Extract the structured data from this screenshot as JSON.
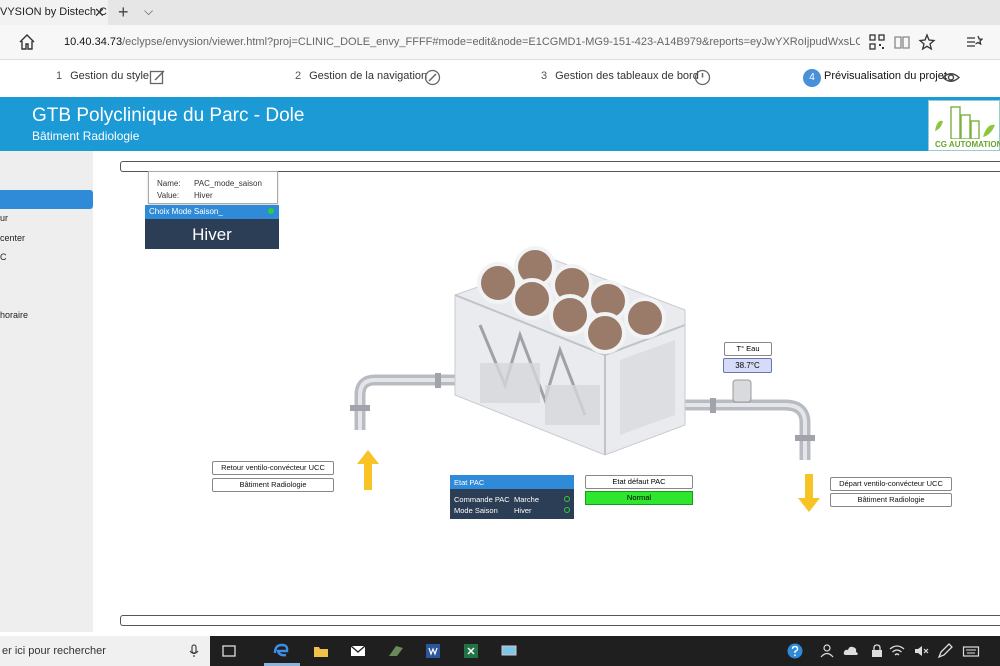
{
  "browser": {
    "tab_title": "VYSION by Distech C",
    "tab_close": "✕",
    "new_tab": "+",
    "tab_dropdown": "⌵",
    "url_host": "10.40.34.73",
    "url_path": "/eclypse/envysion/viewer.html?proj=CLINIC_DOLE_envy_FFFF#mode=edit&node=E1CGMD1-MG9-151-423-A14B979&reports=eyJwYXRoIjpudWxsLCJwYWdlIjpudWxsL"
  },
  "steps": [
    {
      "num": "1",
      "label": "Gestion du style"
    },
    {
      "num": "2",
      "label": "Gestion de la navigation"
    },
    {
      "num": "3",
      "label": "Gestion des tableaux de bord"
    },
    {
      "num": "4",
      "label": "Prévisualisation du projet"
    }
  ],
  "header": {
    "title": "GTB Polyclinique du Parc - Dole",
    "subtitle": "Bâtiment Radiologie",
    "logo_text": "CG AUTOMATION"
  },
  "sidebar": {
    "items": [
      "ur",
      "center",
      "C",
      "horaire"
    ]
  },
  "tooltip": {
    "name_label": "Name:",
    "name_value": "PAC_mode_saison",
    "value_label": "Value:",
    "value_value": "Hiver"
  },
  "choix_mode": {
    "title": "Choix Mode Saison_",
    "value": "Hiver"
  },
  "labels": {
    "retour": "Retour ventilo-convécteur UCC",
    "batiment_left": "Bâtiment Radiologie",
    "depart": "Départ ventilo-convécteur UCC",
    "batiment_right": "Bâtiment Radiologie",
    "temp_title": "T° Eau",
    "temp_value": "38.7°C"
  },
  "etat_pac": {
    "title": "Etat PAC",
    "rows": [
      {
        "label": "Commande PAC",
        "value": "Marche"
      },
      {
        "label": "Mode Saison",
        "value": "Hiver"
      }
    ]
  },
  "etat_defaut": {
    "title": "Etat défaut PAC",
    "value": "Normal"
  },
  "taskbar": {
    "search_placeholder": "er ici pour rechercher"
  },
  "colors": {
    "header_blue": "#1b9ad6",
    "active_blue": "#2f8ad8",
    "panel_dark": "#2c3e55",
    "status_green": "#2de62d"
  }
}
